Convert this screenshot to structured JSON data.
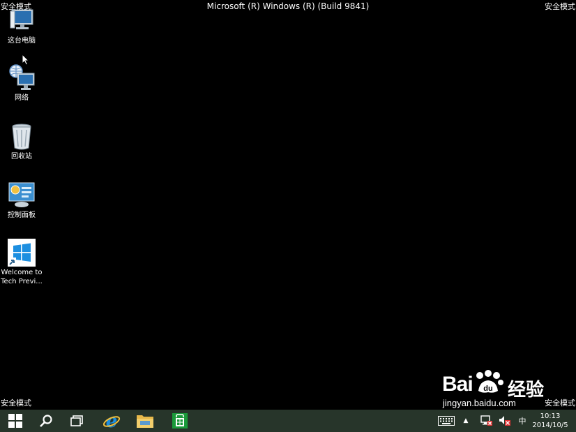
{
  "overlay": {
    "safe_mode": "安全模式",
    "build_title": "Microsoft (R) Windows (R) (Build 9841)"
  },
  "desktop": {
    "icons": [
      {
        "label": "这台电脑",
        "icon": "this-pc-icon"
      },
      {
        "label": "网络",
        "icon": "network-icon"
      },
      {
        "label": "回收站",
        "icon": "recycle-bin-icon"
      },
      {
        "label": "控制面板",
        "icon": "control-panel-icon"
      },
      {
        "label_line1": "Welcome to",
        "label_line2": "Tech Previ...",
        "icon": "windows-logo-icon"
      }
    ]
  },
  "watermark": {
    "brand_left": "Bai",
    "brand_right": "经验",
    "url": "jingyan.baidu.com"
  },
  "taskbar": {
    "background": "#27352a",
    "pinned": [
      "start-button",
      "search-button",
      "task-view-button",
      "internet-explorer",
      "file-explorer",
      "store"
    ],
    "tray": {
      "chevron": "▲",
      "ime": "中",
      "time": "10:13",
      "date": "2014/10/5"
    }
  },
  "colors": {
    "desktop_background": "#000000",
    "ie_blue": "#1d8fe0",
    "folder_yellow": "#e7b84a",
    "store_green": "#1a9a3a",
    "alert_red": "#e03030"
  }
}
